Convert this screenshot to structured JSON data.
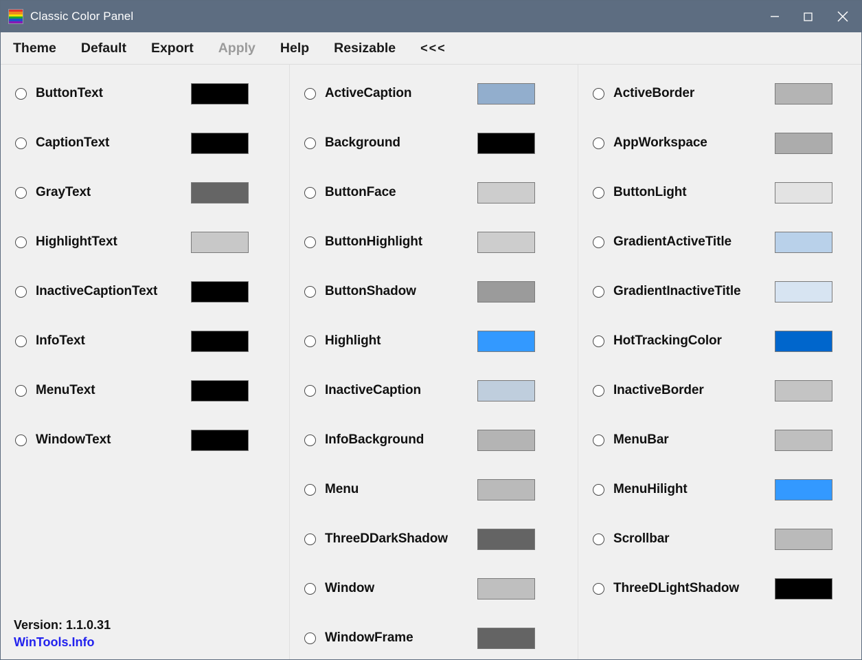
{
  "window": {
    "title": "Classic Color Panel",
    "icon": "rainbow-palette-icon",
    "titlebar_color": "#5d6d81",
    "controls": {
      "minimize": "minimize-icon",
      "maximize": "maximize-icon",
      "close": "close-icon"
    }
  },
  "menu": {
    "items": [
      {
        "label": "Theme",
        "enabled": true
      },
      {
        "label": "Default",
        "enabled": true
      },
      {
        "label": "Export",
        "enabled": true
      },
      {
        "label": "Apply",
        "enabled": false
      },
      {
        "label": "Help",
        "enabled": true
      },
      {
        "label": "Resizable",
        "enabled": true
      },
      {
        "label": "<<<",
        "enabled": true
      }
    ]
  },
  "columns": [
    {
      "id": "column-1",
      "rows": [
        {
          "label": "ButtonText",
          "color": "#000000",
          "selected": false
        },
        {
          "label": "CaptionText",
          "color": "#000000",
          "selected": false
        },
        {
          "label": "GrayText",
          "color": "#656565",
          "selected": false
        },
        {
          "label": "HighlightText",
          "color": "#c8c8c8",
          "selected": false
        },
        {
          "label": "InactiveCaptionText",
          "color": "#000000",
          "selected": false
        },
        {
          "label": "InfoText",
          "color": "#000000",
          "selected": false
        },
        {
          "label": "MenuText",
          "color": "#000000",
          "selected": false
        },
        {
          "label": "WindowText",
          "color": "#000000",
          "selected": false
        }
      ]
    },
    {
      "id": "column-2",
      "rows": [
        {
          "label": "ActiveCaption",
          "color": "#92aecd",
          "selected": false
        },
        {
          "label": "Background",
          "color": "#000000",
          "selected": false
        },
        {
          "label": "ButtonFace",
          "color": "#cdcdcd",
          "selected": false
        },
        {
          "label": "ButtonHighlight",
          "color": "#cdcdcd",
          "selected": false
        },
        {
          "label": "ButtonShadow",
          "color": "#9b9b9b",
          "selected": false
        },
        {
          "label": "Highlight",
          "color": "#3399ff",
          "selected": false
        },
        {
          "label": "InactiveCaption",
          "color": "#bfcedd",
          "selected": false
        },
        {
          "label": "InfoBackground",
          "color": "#b4b4b4",
          "selected": false
        },
        {
          "label": "Menu",
          "color": "#bababa",
          "selected": false
        },
        {
          "label": "ThreeDDarkShadow",
          "color": "#646464",
          "selected": false
        },
        {
          "label": "Window",
          "color": "#bfbfbf",
          "selected": false
        },
        {
          "label": "WindowFrame",
          "color": "#646464",
          "selected": false
        }
      ]
    },
    {
      "id": "column-3",
      "rows": [
        {
          "label": "ActiveBorder",
          "color": "#b4b4b4",
          "selected": false
        },
        {
          "label": "AppWorkspace",
          "color": "#acacac",
          "selected": false
        },
        {
          "label": "ButtonLight",
          "color": "#e3e3e3",
          "selected": false
        },
        {
          "label": "GradientActiveTitle",
          "color": "#b9d1ea",
          "selected": false
        },
        {
          "label": "GradientInactiveTitle",
          "color": "#d7e4f2",
          "selected": false
        },
        {
          "label": "HotTrackingColor",
          "color": "#0066cc",
          "selected": false
        },
        {
          "label": "InactiveBorder",
          "color": "#c4c4c4",
          "selected": false
        },
        {
          "label": "MenuBar",
          "color": "#bfbfbf",
          "selected": false
        },
        {
          "label": "MenuHilight",
          "color": "#3399ff",
          "selected": false
        },
        {
          "label": "Scrollbar",
          "color": "#bababa",
          "selected": false
        },
        {
          "label": "ThreeDLightShadow",
          "color": "#000000",
          "selected": false
        }
      ]
    }
  ],
  "footer": {
    "version": "Version: 1.1.0.31",
    "link": "WinTools.Info",
    "link_color": "#2222ee"
  }
}
